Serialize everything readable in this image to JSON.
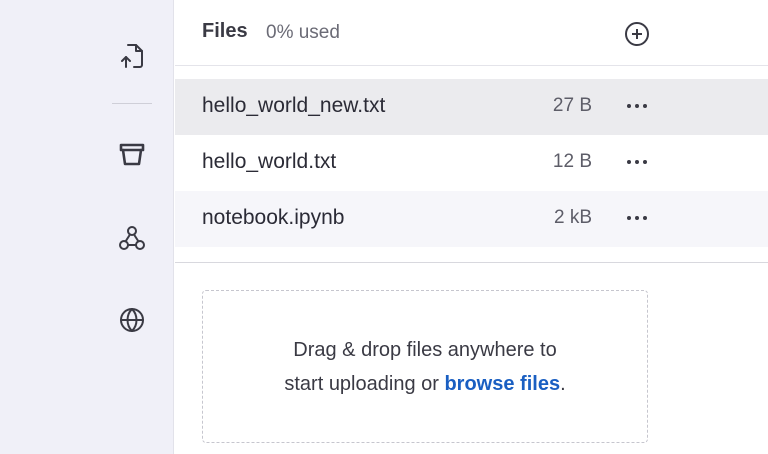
{
  "sidebar": {
    "icons": [
      "upload-file-icon",
      "storage-icon",
      "webhooks-icon",
      "globe-icon"
    ]
  },
  "header": {
    "title": "Files",
    "usage": "0% used",
    "add_icon": "plus-circle-icon"
  },
  "files": [
    {
      "name": "hello_world_new.txt",
      "size": "27 B"
    },
    {
      "name": "hello_world.txt",
      "size": "12 B"
    },
    {
      "name": "notebook.ipynb",
      "size": "2 kB"
    }
  ],
  "dropzone": {
    "line1": "Drag & drop files anywhere to",
    "line2_prefix": "start uploading or ",
    "browse_link": "browse files",
    "line2_suffix": "."
  },
  "colors": {
    "sidebar_bg": "#f0f0f8",
    "hover_row": "#ebebee",
    "alt_row": "#f6f6fa",
    "link": "#1a5fc2"
  }
}
